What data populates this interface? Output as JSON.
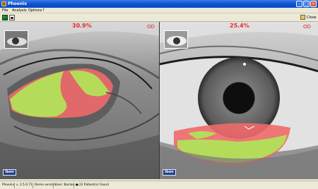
{
  "window": {
    "title": "Phoenix"
  },
  "menu": [
    "File",
    "Analysis",
    "Options",
    "?"
  ],
  "toolbar": {
    "close_label": "Close"
  },
  "left_image": {
    "percent": "30.9%",
    "side": "OD",
    "logo": "Ibon"
  },
  "right_image": {
    "percent": "25.4%",
    "side": "OD",
    "logo": "Ibon"
  },
  "status": {
    "app": "Phoenix",
    "version": "v. 2.5.0.71",
    "mode": "Demo version",
    "user": "User: Baclow",
    "patients": "22 Patient(s) Found"
  },
  "colors": {
    "highlight_green": "#b4dc5a",
    "highlight_red": "#f06a6a",
    "title_bar": "#0a54d4"
  }
}
